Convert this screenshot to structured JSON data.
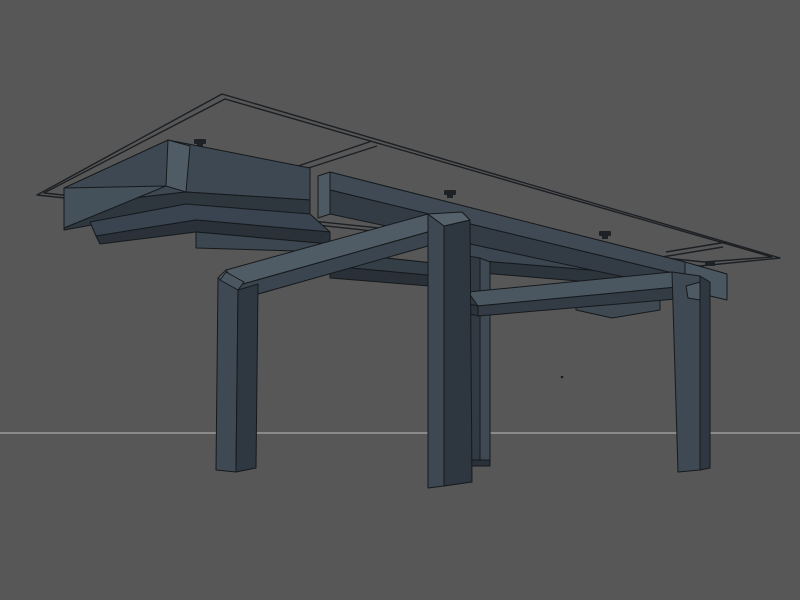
{
  "viewport": {
    "background": "#575757",
    "horizon_color": "#bdbdbd",
    "model_colors": {
      "light_face": "#4d5a64",
      "mid_face": "#3d4852",
      "dark_face": "#2b333b",
      "edge": "#16191c"
    }
  },
  "model": {
    "name": "table-base",
    "parts": [
      "tabletop-outline",
      "front-apron",
      "side-rail",
      "inner-beam",
      "front-frame-crossbar",
      "right-frame-crossbar",
      "front-left-leg",
      "front-center-leg",
      "back-center-leg",
      "right-leg",
      "mounting-screw"
    ]
  }
}
